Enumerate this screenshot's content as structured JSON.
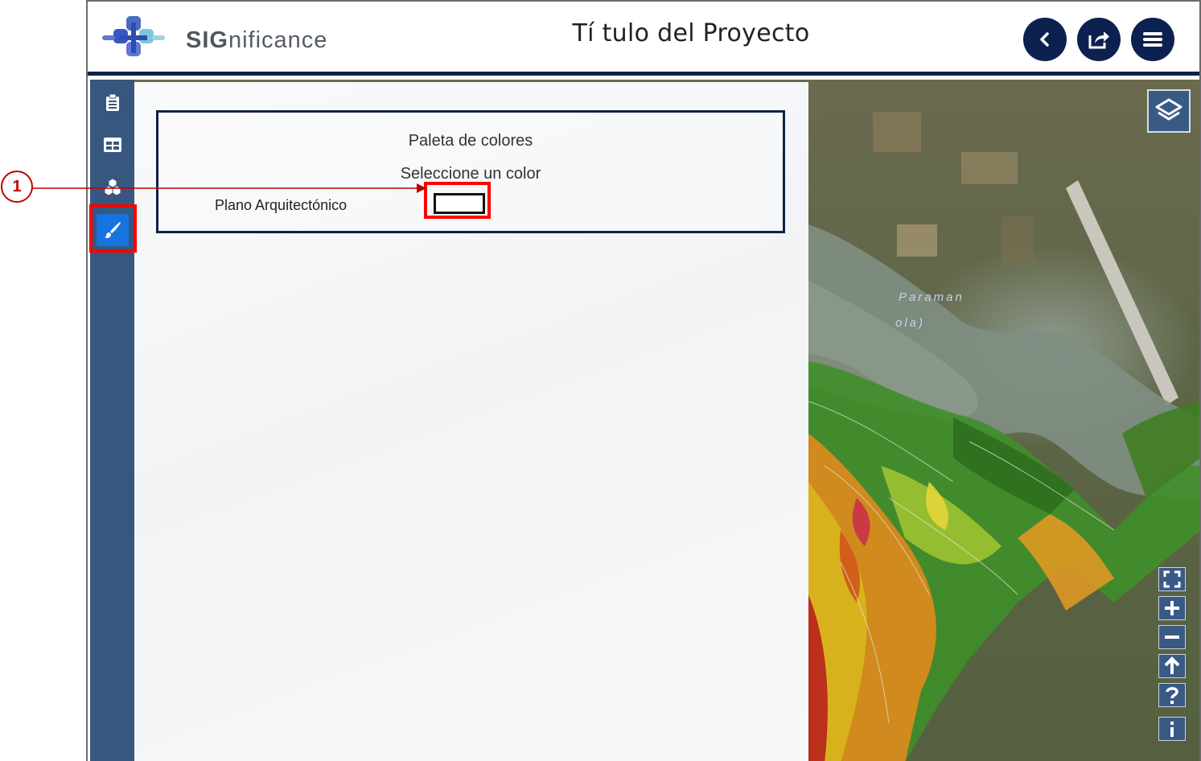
{
  "header": {
    "brand_bold": "SIG",
    "brand_rest": "nificance",
    "title": "Tí tulo del Proyecto",
    "buttons": [
      {
        "name": "back-button",
        "icon": "chevron-left-icon"
      },
      {
        "name": "share-button",
        "icon": "share-icon"
      },
      {
        "name": "menu-button",
        "icon": "hamburger-menu-icon"
      }
    ]
  },
  "sidebar": {
    "items": [
      {
        "name": "sidebar-item-clipboard",
        "icon": "clipboard-icon",
        "active": false
      },
      {
        "name": "sidebar-item-table",
        "icon": "table-icon",
        "active": false
      },
      {
        "name": "sidebar-item-layers-group",
        "icon": "cubes-icon",
        "active": false
      },
      {
        "name": "sidebar-item-paint",
        "icon": "paintbrush-icon",
        "active": true
      }
    ]
  },
  "panel": {
    "title": "Paleta de colores",
    "subtitle": "Seleccione un color",
    "layer_label": "Plano Arquitectónico",
    "swatch_color": "#ffffff"
  },
  "annotation": {
    "callout_number": "1"
  },
  "map": {
    "labels": [
      "Paraman",
      "ola)"
    ],
    "tools": [
      "fullscreen-icon",
      "zoom-in-icon",
      "zoom-out-icon",
      "north-arrow-icon",
      "help-icon",
      "info-icon"
    ]
  },
  "colors": {
    "navy": "#0d2150",
    "sidebar": "#37577f",
    "active": "#1574df",
    "highlight": "#ff0000"
  }
}
